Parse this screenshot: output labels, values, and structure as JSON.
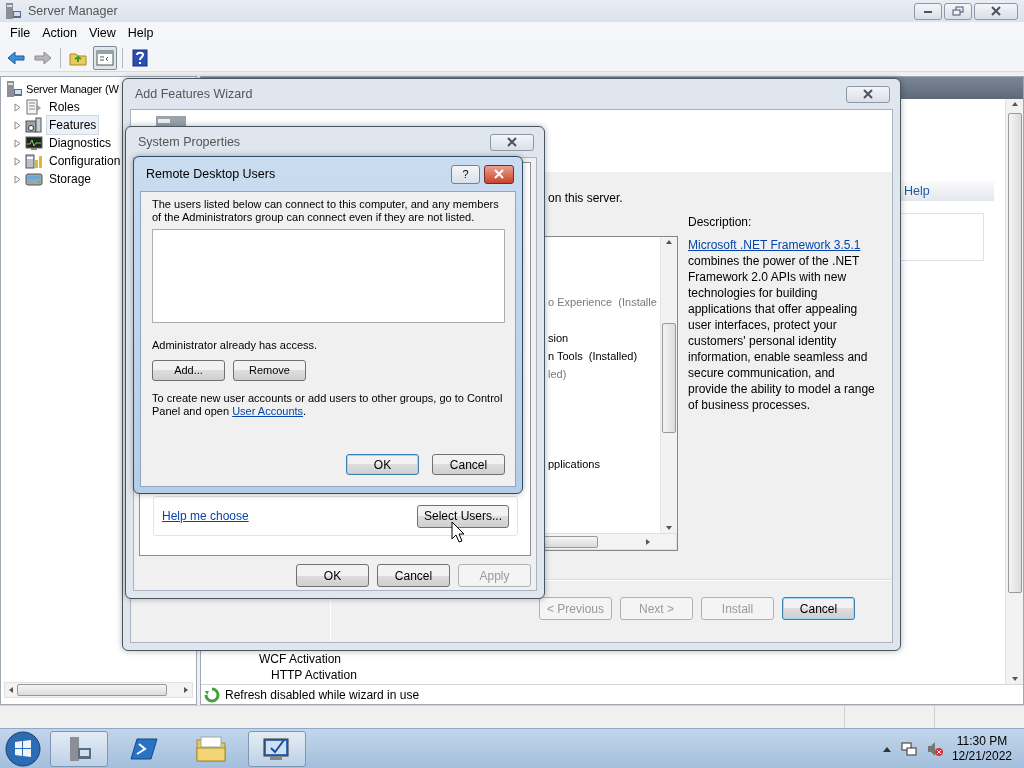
{
  "server_manager": {
    "title": "Server Manager",
    "menu": [
      "File",
      "Action",
      "View",
      "Help"
    ],
    "tree": {
      "root": "Server Manager (W",
      "items": [
        {
          "label": "Roles",
          "kind": "roles",
          "selected": false
        },
        {
          "label": "Features",
          "kind": "features",
          "selected": true
        },
        {
          "label": "Diagnostics",
          "kind": "diagnostics",
          "selected": false
        },
        {
          "label": "Configuration",
          "kind": "configuration",
          "selected": false
        },
        {
          "label": "Storage",
          "kind": "storage",
          "selected": false
        }
      ]
    },
    "help_header": "Help",
    "rows": [
      "WCF Activation",
      "HTTP Activation"
    ],
    "status_text": "Refresh disabled while wizard in use"
  },
  "add_features_wizard": {
    "title": "Add Features Wizard",
    "intro": "on this server.",
    "features": [
      {
        "label": "o Experience  (Installe",
        "disabled": true
      },
      {
        "label": "sion",
        "disabled": false
      },
      {
        "label": "n Tools  (Installed)",
        "disabled": false
      },
      {
        "label": "led)",
        "disabled": true
      },
      {
        "label": "pplications",
        "disabled": false
      }
    ],
    "description_label": "Description:",
    "description_link": "Microsoft .NET Framework 3.5.1",
    "description_text": " combines the power of the .NET Framework 2.0 APIs with new technologies for building applications that offer appealing user interfaces, protect your customers' personal identity information, enable seamless and secure communication, and provide the ability to model a range of business processes.",
    "buttons": [
      {
        "label": "< Previous",
        "disabled": true,
        "default": false
      },
      {
        "label": "Next >",
        "disabled": true,
        "default": false
      },
      {
        "label": "Install",
        "disabled": true,
        "default": false
      },
      {
        "label": "Cancel",
        "disabled": false,
        "default": true
      }
    ]
  },
  "system_properties": {
    "title": "System Properties",
    "help_link": "Help me choose",
    "select_button": "Select Users...",
    "buttons": [
      {
        "label": "OK",
        "disabled": false,
        "default": false
      },
      {
        "label": "Cancel",
        "disabled": false,
        "default": false
      },
      {
        "label": "Apply",
        "disabled": true,
        "default": false
      }
    ]
  },
  "remote_desktop_users": {
    "title": "Remote Desktop Users",
    "help_button": "?",
    "intro": "The users listed below can connect to this computer, and any members of the Administrators group can connect even if they are not listed.",
    "access_note": "Administrator already has access.",
    "list_buttons": [
      "Add...",
      "Remove"
    ],
    "accounts_note": "To create new user accounts or add users to other groups, go to Control Panel and open ",
    "accounts_link": "User Accounts",
    "accounts_note_end": ".",
    "buttons": [
      {
        "label": "OK",
        "disabled": false,
        "default": true
      },
      {
        "label": "Cancel",
        "disabled": false,
        "default": false
      }
    ]
  },
  "taskbar": {
    "apps": [
      {
        "kind": "server-manager",
        "selected": true
      },
      {
        "kind": "powershell",
        "selected": false
      },
      {
        "kind": "explorer",
        "selected": false
      },
      {
        "kind": "system-properties",
        "selected": true
      }
    ],
    "time": "11:30 PM",
    "date": "12/21/2022"
  }
}
